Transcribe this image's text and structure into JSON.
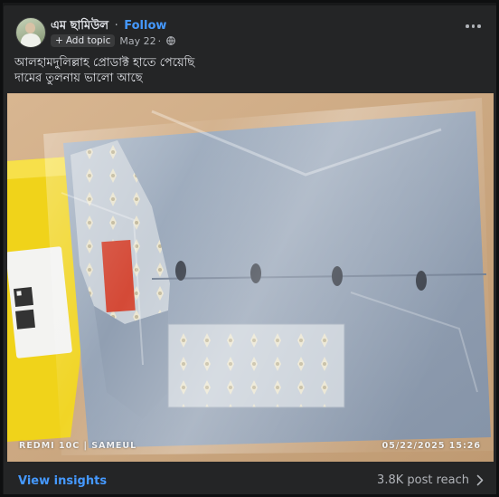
{
  "post": {
    "author": "এম ছামিউল",
    "separator": "·",
    "follow_label": "Follow",
    "add_topic_label": "Add topic",
    "date": "May 22",
    "date_separator": "·",
    "privacy_icon": "globe-icon",
    "more_icon": "more-options-icon",
    "text_line1": "আলহামদুলিল্লাহ প্রোডাক্ট হাতে পেয়েছি",
    "text_line2": "দামের তুলনায় ভালো আছে"
  },
  "photo": {
    "camera_watermark": "REDMI 10C | SAMEUL",
    "timestamp_watermark": "05/22/2025  15:26"
  },
  "footer": {
    "insights_label": "View insights",
    "reach_label": "3.8K post reach",
    "chevron_icon": "chevron-right-icon"
  },
  "colors": {
    "background": "#18191a",
    "card": "#242526",
    "accent": "#4599ff",
    "text_primary": "#e4e6eb",
    "text_secondary": "#b0b3b8"
  }
}
